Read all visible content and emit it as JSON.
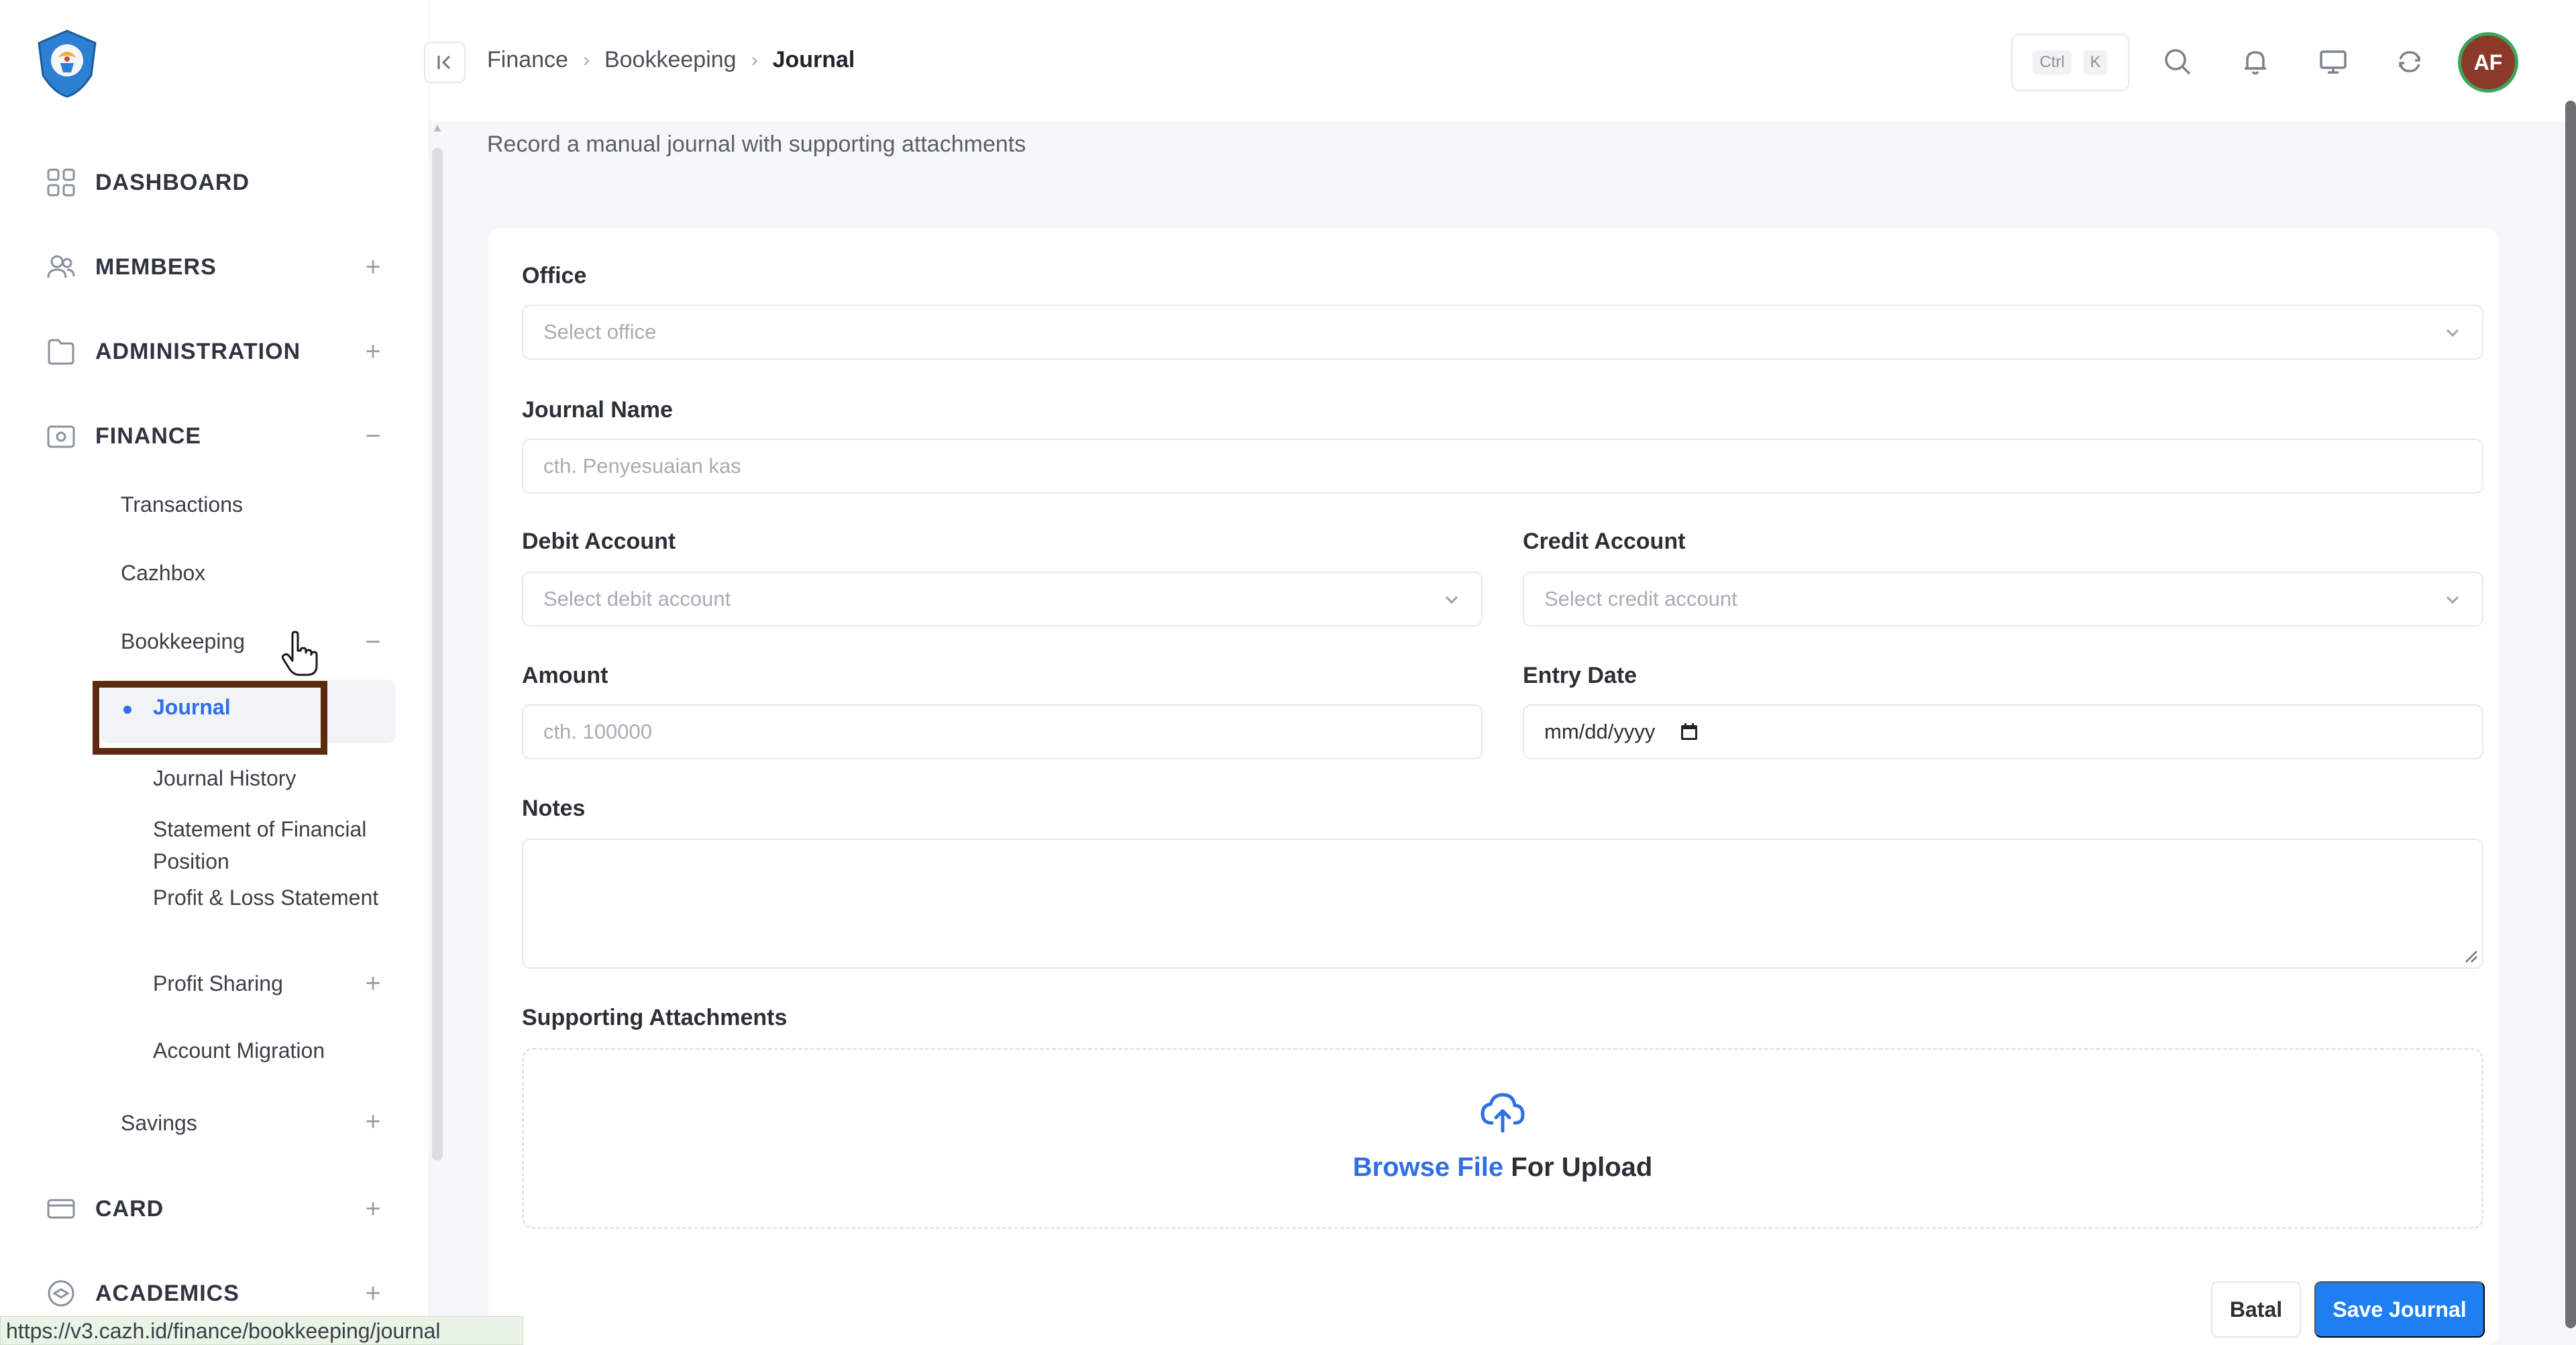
{
  "sidebar": {
    "logo_icon": "tut-wuri-handayani-logo",
    "items": [
      {
        "label": "DASHBOARD",
        "icon": "grid-icon",
        "toggle": ""
      },
      {
        "label": "MEMBERS",
        "icon": "users-icon",
        "toggle": "+"
      },
      {
        "label": "ADMINISTRATION",
        "icon": "folder-icon",
        "toggle": "+"
      },
      {
        "label": "FINANCE",
        "icon": "wallet-icon",
        "toggle": "−"
      },
      {
        "label": "CARD",
        "icon": "card-icon",
        "toggle": "+"
      },
      {
        "label": "ACADEMICS",
        "icon": "academic-icon",
        "toggle": "+"
      }
    ],
    "finance_children": [
      {
        "label": "Transactions",
        "toggle": ""
      },
      {
        "label": "Cazhbox",
        "toggle": ""
      },
      {
        "label": "Bookkeeping",
        "toggle": "−"
      },
      {
        "label": "Savings",
        "toggle": "+"
      }
    ],
    "bookkeeping_children": [
      {
        "label": "Journal",
        "active": true
      },
      {
        "label": "Journal History"
      },
      {
        "label": "Statement of Financial Position"
      },
      {
        "label": "Profit & Loss Statement"
      },
      {
        "label": "Profit Sharing",
        "toggle": "+"
      },
      {
        "label": "Account Migration"
      }
    ]
  },
  "status_bar": {
    "url": "https://v3.cazh.id/finance/bookkeeping/journal"
  },
  "topbar": {
    "collapse_icon": "collapse-left-icon",
    "breadcrumb": [
      "Finance",
      "Bookkeeping",
      "Journal"
    ],
    "shortcut": {
      "key1": "Ctrl",
      "key2": "K"
    },
    "icons": [
      "search-icon",
      "bell-icon",
      "monitor-icon",
      "refresh-icon"
    ],
    "avatar_initials": "AF"
  },
  "page": {
    "subtitle": "Record a manual journal with supporting attachments"
  },
  "form": {
    "office": {
      "label": "Office",
      "placeholder": "Select office"
    },
    "journal_name": {
      "label": "Journal Name",
      "placeholder": "cth. Penyesuaian kas"
    },
    "debit_account": {
      "label": "Debit Account",
      "placeholder": "Select debit account"
    },
    "credit_account": {
      "label": "Credit Account",
      "placeholder": "Select credit account"
    },
    "amount": {
      "label": "Amount",
      "placeholder": "cth. 100000"
    },
    "entry_date": {
      "label": "Entry Date",
      "placeholder": "mm/dd/yyyy"
    },
    "notes": {
      "label": "Notes"
    },
    "attachments": {
      "label": "Supporting Attachments",
      "browse_link": "Browse File",
      "upload_suffix": " For Upload"
    },
    "cancel_label": "Batal",
    "save_label": "Save Journal"
  },
  "colors": {
    "accent": "#1f7ff0",
    "active_link": "#2f6fe4",
    "highlight_border": "#5b2a0f",
    "avatar_bg": "#8b3a2a",
    "avatar_ring": "#3fa35c"
  }
}
